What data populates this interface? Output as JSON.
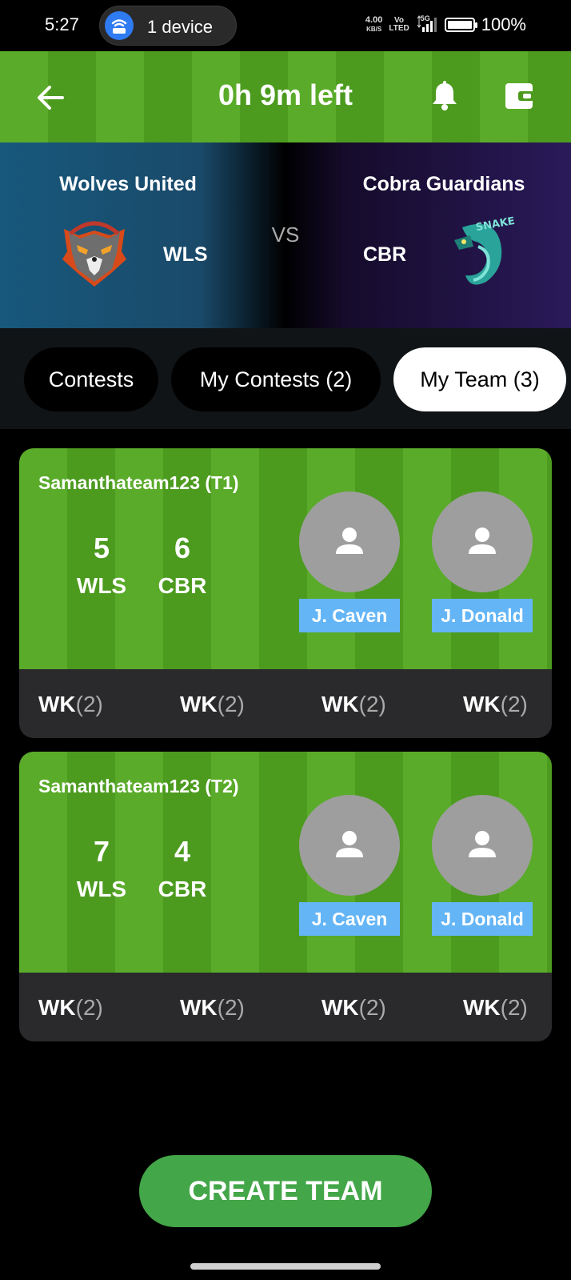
{
  "status_bar": {
    "time": "5:27",
    "device_label": "1 device",
    "net_speed": "4.00",
    "net_unit": "KB/S",
    "vo_top": "Vo",
    "vo_bottom": "LTED",
    "network": "5G",
    "battery": "100%"
  },
  "header": {
    "title": "0h 9m left"
  },
  "match": {
    "home": {
      "name": "Wolves United",
      "code": "WLS"
    },
    "away": {
      "name": "Cobra Guardians",
      "code": "CBR",
      "logo_text": "SNAKE"
    },
    "vs": "VS"
  },
  "tabs": [
    {
      "label": "Contests",
      "active": false
    },
    {
      "label": "My Contests (2)",
      "active": false
    },
    {
      "label": "My Team (3)",
      "active": true
    }
  ],
  "teams": [
    {
      "name": "Samanthateam123 (T1)",
      "home_count": "5",
      "home_code": "WLS",
      "away_count": "6",
      "away_code": "CBR",
      "players": [
        "J. Caven",
        "J. Donald"
      ],
      "roles": [
        {
          "role": "WK",
          "count": "(2)"
        },
        {
          "role": "WK",
          "count": "(2)"
        },
        {
          "role": "WK",
          "count": "(2)"
        },
        {
          "role": "WK",
          "count": "(2)"
        }
      ]
    },
    {
      "name": "Samanthateam123 (T2)",
      "home_count": "7",
      "home_code": "WLS",
      "away_count": "4",
      "away_code": "CBR",
      "players": [
        "J. Caven",
        "J. Donald"
      ],
      "roles": [
        {
          "role": "WK",
          "count": "(2)"
        },
        {
          "role": "WK",
          "count": "(2)"
        },
        {
          "role": "WK",
          "count": "(2)"
        },
        {
          "role": "WK",
          "count": "(2)"
        }
      ]
    }
  ],
  "create_button": "CREATE TEAM",
  "colors": {
    "field_light": "#5aab2a",
    "field_dark": "#4c9b1f",
    "accent_green": "#43a648",
    "player_label": "#64b5f6"
  }
}
